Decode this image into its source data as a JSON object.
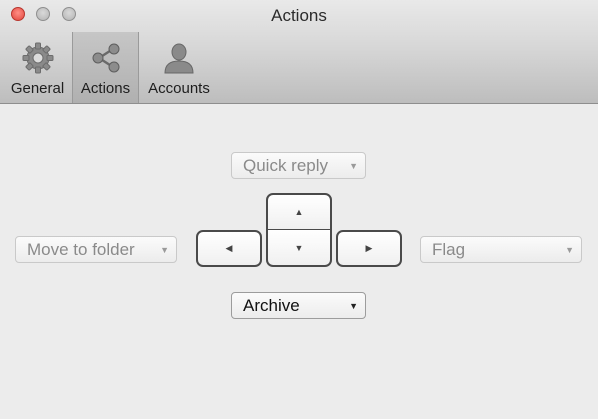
{
  "window": {
    "title": "Actions"
  },
  "toolbar": {
    "tabs": [
      {
        "label": "General",
        "icon": "gear-icon",
        "selected": false
      },
      {
        "label": "Actions",
        "icon": "share-icon",
        "selected": true
      },
      {
        "label": "Accounts",
        "icon": "person-icon",
        "selected": false
      }
    ]
  },
  "actions": {
    "up": {
      "value": "Quick reply",
      "enabled": false
    },
    "left": {
      "value": "Move to folder",
      "enabled": false
    },
    "right": {
      "value": "Flag",
      "enabled": false
    },
    "down": {
      "value": "Archive",
      "enabled": true
    }
  },
  "keys": {
    "up": "▲",
    "down": "▼",
    "left": "◀",
    "right": "▶"
  },
  "popup_arrow": "▼"
}
